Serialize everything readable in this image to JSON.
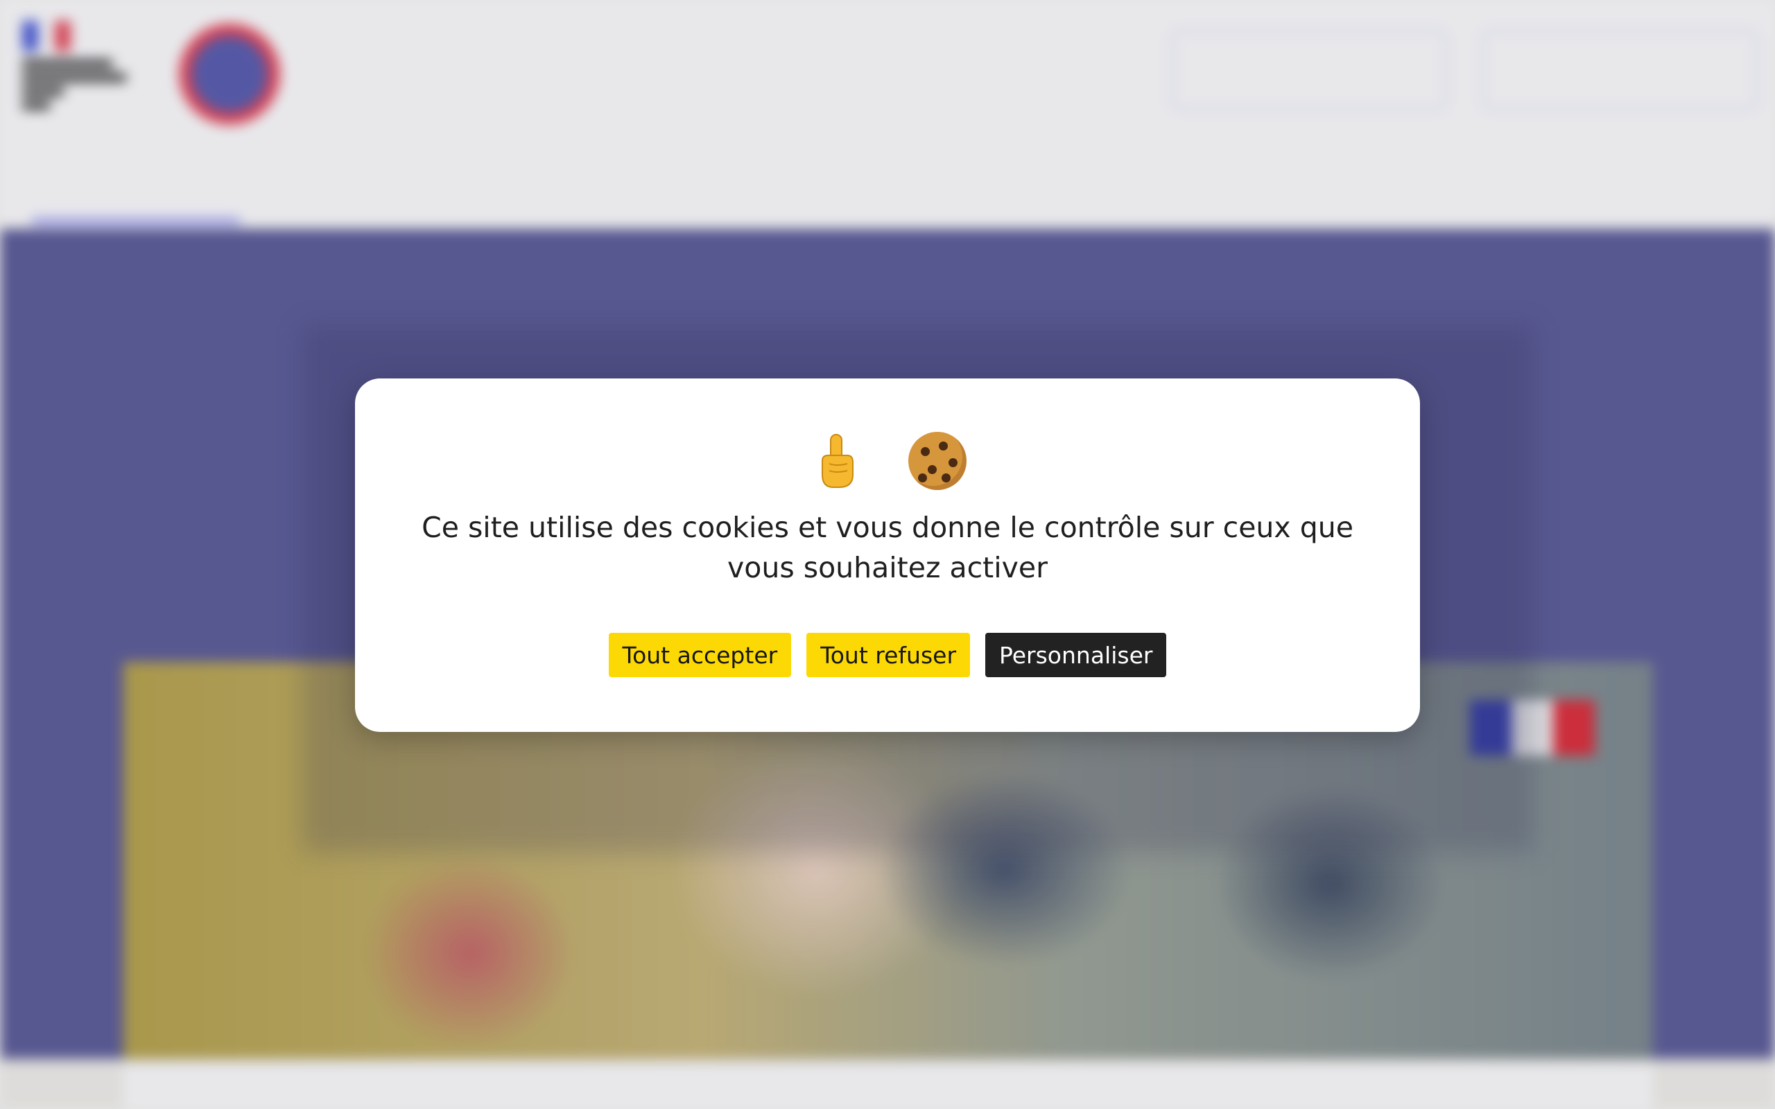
{
  "colors": {
    "accept_button_bg": "#fcd904",
    "refuse_button_bg": "#fcd904",
    "customize_button_bg": "#222222",
    "hero_bg": "#5f5f9b",
    "accent": "#6a6af4"
  },
  "modal": {
    "emojis": [
      "pointing-up-finger-icon",
      "cookie-icon"
    ],
    "message": "Ce site utilise des cookies et vous donne le contrôle sur ceux que vous souhaitez activer",
    "buttons": {
      "accept": "Tout accepter",
      "refuse": "Tout refuser",
      "customize": "Personnaliser"
    }
  }
}
